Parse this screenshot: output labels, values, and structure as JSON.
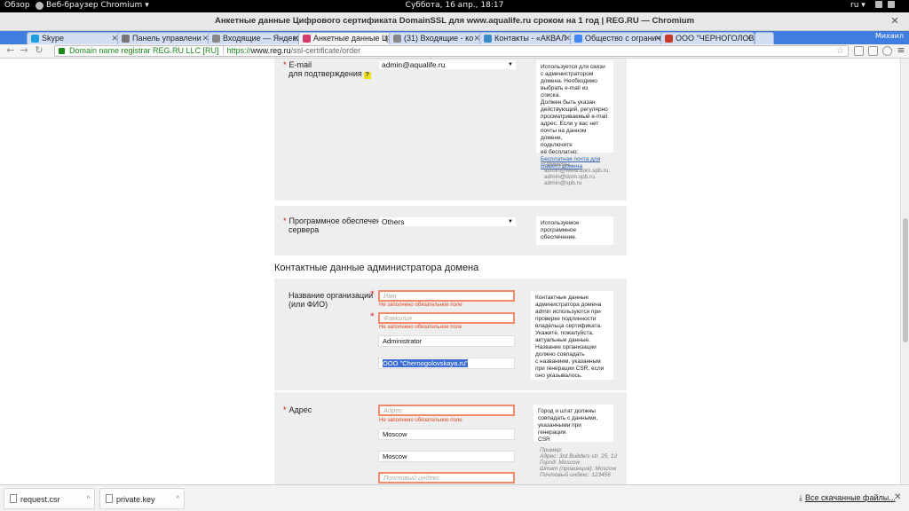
{
  "topbar": {
    "overview": "Обзор",
    "app_name": "Веб-браузер Chromium",
    "clock": "Суббота, 16 апр., 18:17",
    "lang": "ru"
  },
  "window": {
    "title": "Анкетные данные Цифрового сертификата DomainSSL для www.aqualife.ru сроком на 1 год | REG.RU — Chromium"
  },
  "tabs": [
    {
      "label": "Skype",
      "color": "#1aa0e0"
    },
    {
      "label": "Панель управлени",
      "color": "#777777"
    },
    {
      "label": "Входящие — Яндекс",
      "color": "#888888"
    },
    {
      "label": "Анкетные данные Ц",
      "color": "#d83a6a"
    },
    {
      "label": "(31) Входящие - ко",
      "color": "#888888"
    },
    {
      "label": "Контакты - «АКВАЛ",
      "color": "#3a8ac8"
    },
    {
      "label": "Общество с огранич",
      "color": "#4285f4"
    },
    {
      "label": "ООО \"ЧЕРНОГОЛОВ",
      "color": "#c83a2a"
    }
  ],
  "tab_user": "Михаил",
  "omnibox": {
    "ev_badge": "Domain name registrar REG.RU LLC [RU]",
    "scheme": "https://",
    "host": "www.reg.ru",
    "path": "/ssl-certificate/order"
  },
  "email_section": {
    "label_line1": "E-mail",
    "label_line2": "для подтверждения",
    "help": "?",
    "selected": "admin@aqualife.ru",
    "hint": [
      "Используется для связи",
      "с администратором",
      "домена. Необходимо",
      "выбрать e-mail из списка.",
      "Должен быть указан",
      "действующий, регулярно",
      "просматриваемый e-mail",
      "адрес. Если у вас нет",
      "почты на данном домене,",
      "подключите",
      "её бесплатно:"
    ],
    "hint_link": [
      "Бесплатная почта для",
      "Вашего домена"
    ],
    "examples_title": "Примеры:",
    "examples": [
      "admin@www.dom.spb.ru,",
      "admin@dom.spb.ru,",
      "admin@spb.ru"
    ]
  },
  "software_section": {
    "label_line1": "Программное обеспечение",
    "label_line2": "сервера",
    "selected": "Others",
    "hint": [
      "Используемое",
      "программное",
      "обеспечение."
    ]
  },
  "contact_heading": "Контактные данные администратора домена",
  "org_section": {
    "label_line1": "Название организации",
    "label_line2": "(или ФИО)",
    "first_name_placeholder": "Имя",
    "last_name_placeholder": "Фамилия",
    "required_error": "Не заполнено обязательное поле",
    "position_value": "Administrator",
    "company_value": "ООО \"Chernogolovskaya.ru\"",
    "hint": [
      "Контактные данные",
      "администратора домена",
      "admin используются при",
      "проверке подлинности",
      "владельца сертификата.",
      "Укажите, пожалуйста,",
      "актуальные данные.",
      "Название организации",
      "должно совпадать",
      "с названием, указанным",
      "при генерации CSR, если",
      "оно указывалось."
    ]
  },
  "address_section": {
    "label": "Адрес",
    "address_placeholder": "Адрес",
    "required_error": "Не заполнено обязательное поле",
    "city_value": "Moscow",
    "state_value": "Moscow",
    "postal_placeholder": "Почтовый индекс",
    "hint": [
      "Город и штат должны",
      "совпадать с данными,",
      "указанными при генерации",
      "CSR"
    ],
    "example": [
      "Пример:",
      "Адрес: 3rd Builders str. 25, 12",
      "Город: Moscow",
      "Штат (провинция): Moscow",
      "Почтовый индекс: 123456"
    ]
  },
  "downloads": {
    "items": [
      "request.csr",
      "private.key"
    ],
    "show_all": "Все скачанные файлы..."
  }
}
